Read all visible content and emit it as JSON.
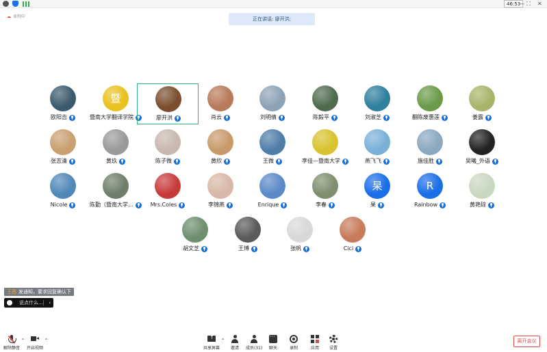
{
  "topbar": {
    "timer": "46:53",
    "minimize_glyph": "—",
    "fullscreen_glyph": "⛶",
    "close_glyph": "✕"
  },
  "recording_tag": "录制中",
  "speaker_banner": "正在讲话: 廖开洪;",
  "participants": [
    {
      "name": "欧阳吉",
      "color": "#3c5a6e"
    },
    {
      "name": "暨南大学翻译学院",
      "color": "#e8c21e",
      "avatar_text": "暨"
    },
    {
      "name": "廖开洪",
      "color": "#7a4e2e",
      "active": true
    },
    {
      "name": "肖云",
      "color": "#b87a5a"
    },
    {
      "name": "刘明倩",
      "color": "#8da3b5"
    },
    {
      "name": "陈毅平",
      "color": "#4f6b4e"
    },
    {
      "name": "刘淑芝",
      "color": "#2f7f9e"
    },
    {
      "name": "翻陈废惠莲",
      "color": "#6b9b4a"
    },
    {
      "name": "姜露",
      "color": "#a9b46a"
    },
    {
      "name": "张志清",
      "color": "#c9a070"
    },
    {
      "name": "黄玖",
      "color": "#9a9a9a"
    },
    {
      "name": "陈子微",
      "color": "#c8b8b0"
    },
    {
      "name": "黄欣",
      "color": "#c89a6a"
    },
    {
      "name": "王微",
      "color": "#4e7ea8"
    },
    {
      "name": "李佳—暨南大学",
      "color": "#d8c22e"
    },
    {
      "name": "燕飞飞",
      "color": "#7ab0d8"
    },
    {
      "name": "施佳胜",
      "color": "#8aa8c0"
    },
    {
      "name": "吴曦_外语",
      "color": "#222222"
    },
    {
      "name": "Nicole",
      "color": "#4f88b8"
    },
    {
      "name": "陈勤（暨南大学…",
      "color": "#6e7e6a"
    },
    {
      "name": "Mrs.Coles",
      "color": "#c83a3a"
    },
    {
      "name": "李锦燕",
      "color": "#d8b8a8"
    },
    {
      "name": "Enrique",
      "color": "#5a88c8"
    },
    {
      "name": "李春",
      "color": "#7e8e6e"
    },
    {
      "name": "杲",
      "color": "#1a6ee8",
      "avatar_text": "杲"
    },
    {
      "name": "Rainbow",
      "color": "#1a6ee8",
      "avatar_text": "R"
    },
    {
      "name": "黄艳琼",
      "color": "#c8d8c0"
    },
    {
      "name": "胡文芝",
      "color": "#6e8e6e"
    },
    {
      "name": "王博",
      "color": "#5a5a5a"
    },
    {
      "name": "张帆",
      "color": "#d8d8d8"
    },
    {
      "name": "Cici",
      "color": "#c87a5a"
    }
  ],
  "chat": {
    "toast_sender": "王茜",
    "toast_text": "发通知，要求回复确认下",
    "input_placeholder": "说点什么...",
    "collapse_glyph": "‹"
  },
  "toolbar": {
    "mute_label": "解除静音",
    "video_label": "开启视频",
    "share_label": "共享屏幕",
    "invite_label": "邀请",
    "members_label": "成员(31)",
    "chat_label": "聊天",
    "record_label": "录制",
    "apps_label": "应用",
    "settings_label": "设置",
    "leave_label": "离开会议",
    "caret_glyph": "^"
  }
}
